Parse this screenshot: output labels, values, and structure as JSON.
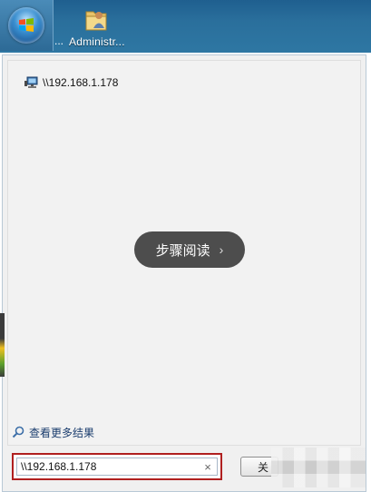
{
  "desktop": {
    "start_orb": "windows-orb-icon",
    "ellipsis_label": "...",
    "folder_icon": "user-folder-icon",
    "folder_label": "Administr..."
  },
  "start_menu": {
    "results": [
      {
        "icon": "network-computer-icon",
        "label": "\\\\192.168.1.178"
      }
    ],
    "overlay_label": "步骤阅读",
    "overlay_chevron": "›",
    "more_results_label": "查看更多结果",
    "search": {
      "value": "\\\\192.168.1.178",
      "clear_glyph": "×"
    },
    "shutdown_label": "关"
  },
  "colors": {
    "highlight_border": "#b02020",
    "taskbar": "#2a6f9c",
    "panel": "#f0f0f0"
  }
}
